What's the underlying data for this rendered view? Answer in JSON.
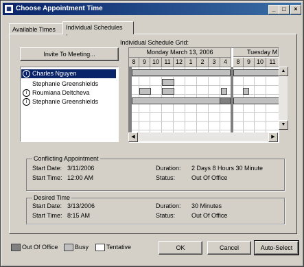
{
  "window": {
    "title": "Choose Appointment Time",
    "minimize": "_",
    "maximize": "□",
    "close": "×"
  },
  "tabs": [
    {
      "label": "Available Times"
    },
    {
      "label": "Individual Schedules"
    }
  ],
  "invite_button": "Invite To Meeting...",
  "attendees": [
    {
      "name": "Charles Nguyen",
      "icon": "info-icon",
      "selected": true
    },
    {
      "name": "Stephanie Greenshields",
      "icon": "",
      "selected": false
    },
    {
      "name": "Roumiana Deltcheva",
      "icon": "info-icon",
      "selected": false
    },
    {
      "name": "Stephanie Greenshields",
      "icon": "info-icon",
      "selected": false
    }
  ],
  "schedule": {
    "label": "Individual Schedule Grid:",
    "days": [
      "Monday March 13, 2006",
      "Tuesday M"
    ],
    "hours_day1": [
      "8",
      "9",
      "10",
      "11",
      "12",
      "1",
      "2",
      "3",
      "4"
    ],
    "hours_day2": [
      "8",
      "9",
      "10",
      "11"
    ]
  },
  "conflict": {
    "title": "Conflicting Appointment",
    "start_date_label": "Start Date:",
    "start_date": "3/11/2006",
    "start_time_label": "Start Time:",
    "start_time": "12:00 AM",
    "duration_label": "Duration:",
    "duration": "2 Days 8 Hours 30 Minute",
    "status_label": "Status:",
    "status": "Out Of Office"
  },
  "desired": {
    "title": "Desired Time",
    "start_date_label": "Start Date:",
    "start_date": "3/13/2006",
    "start_time_label": "Start Time:",
    "start_time": "8:15 AM",
    "duration_label": "Duration:",
    "duration": "30 Minutes",
    "status_label": "Status:",
    "status": "Out Of Office"
  },
  "legend": [
    {
      "label": "Out Of Office",
      "color": "#808080"
    },
    {
      "label": "Busy",
      "color": "#c0c0c0"
    },
    {
      "label": "Tentative",
      "color": "#ffffff"
    }
  ],
  "buttons": {
    "ok": "OK",
    "cancel": "Cancel",
    "auto_select": "Auto-Select"
  }
}
